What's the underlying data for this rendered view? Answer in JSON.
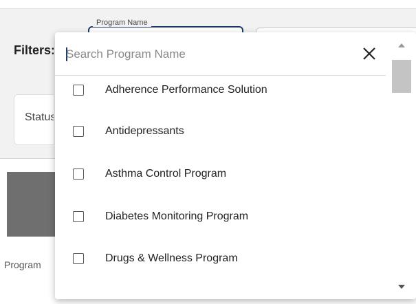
{
  "filters": {
    "label": "Filters:",
    "program_name_label": "Program Name",
    "status_label": "Status"
  },
  "background": {
    "program_column_label": "Program"
  },
  "dropdown": {
    "search_placeholder": "Search Program Name",
    "search_value": "",
    "items": [
      {
        "label": "Adherence Performance Solution",
        "checked": false
      },
      {
        "label": "Antidepressants",
        "checked": false
      },
      {
        "label": "Asthma Control Program",
        "checked": false
      },
      {
        "label": "Diabetes Monitoring Program",
        "checked": false
      },
      {
        "label": "Drugs & Wellness Program",
        "checked": false
      }
    ]
  },
  "icons": {
    "close": "close-icon",
    "scroll_up": "scroll-up-arrow",
    "scroll_down": "scroll-down-arrow"
  },
  "colors": {
    "accent": "#1f3a6b",
    "header_gray": "#6f6f6f"
  }
}
